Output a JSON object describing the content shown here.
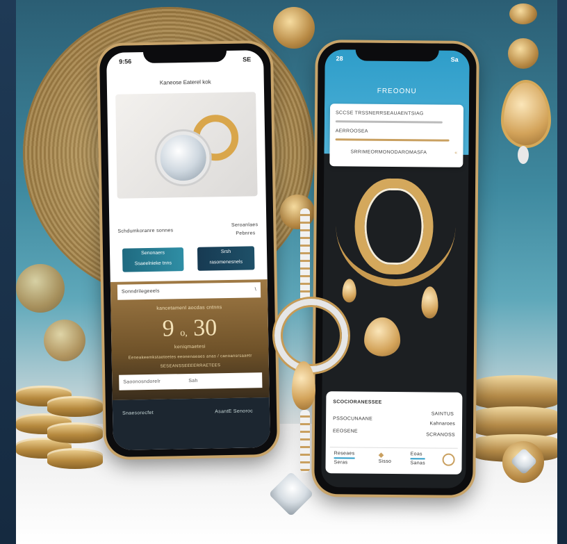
{
  "left_phone": {
    "status_time": "9:56",
    "status_right": "SE",
    "header": "Kaneose Eaterel kok",
    "section_label": "Schdumkoranre sonnes",
    "section_side_line1": "Seroanlaes",
    "section_side_line2": "Pebnres",
    "button_primary_label": "Senonaers",
    "button_primary_sub": "Ssaeelnieke tnns",
    "button_secondary_label": "Srsh",
    "button_secondary_sub": "rasomenesnels",
    "dropdown_value": "Sonndrilegeeels",
    "dropdown_chevron": "\\",
    "caption_top": "kancetamenl aocdas cntnns",
    "price_left": "9",
    "price_small": "o,",
    "price_right": "30",
    "caption_sub": "keniqmaetesi",
    "caption_lines": "Eeneakeemkstaeteetes eeonenaeaes anas / canoansrsaaetr",
    "meta_line": "SESEANSSEEEERRAETEES",
    "input_placeholder": "Saoonosndorelr",
    "input_side": "Sah",
    "footer_left": "Snaesorecfet",
    "footer_right": "AsantE Senoroc"
  },
  "right_phone": {
    "status_time": "28",
    "status_right": "Sa",
    "title": "FREOONU",
    "card_line1": "SCCSE TRSSNERRSEAUAENTSIAG",
    "card_line2": "AERROOSEA",
    "card_line3": "SRRIMEORMONODAROMASFA",
    "card_hint": "«",
    "detail_title": "SCOCIORANESSEE",
    "detail_item1": "PSSOCUNAANE",
    "detail_item2": "EEOSENE",
    "detail_right1": "SAINTUS",
    "detail_right2": "Kahnaroes",
    "detail_right3": "SCRANOSS",
    "tab1": "Reseaes",
    "tab1_sub": "Seras",
    "tab2": "Sisso",
    "tab3": "Eoas",
    "tab3_sub": "Sanas"
  },
  "colors": {
    "accent_gold": "#c9a060",
    "accent_blue": "#2e9dc9",
    "dark_teal": "#1f6070"
  }
}
